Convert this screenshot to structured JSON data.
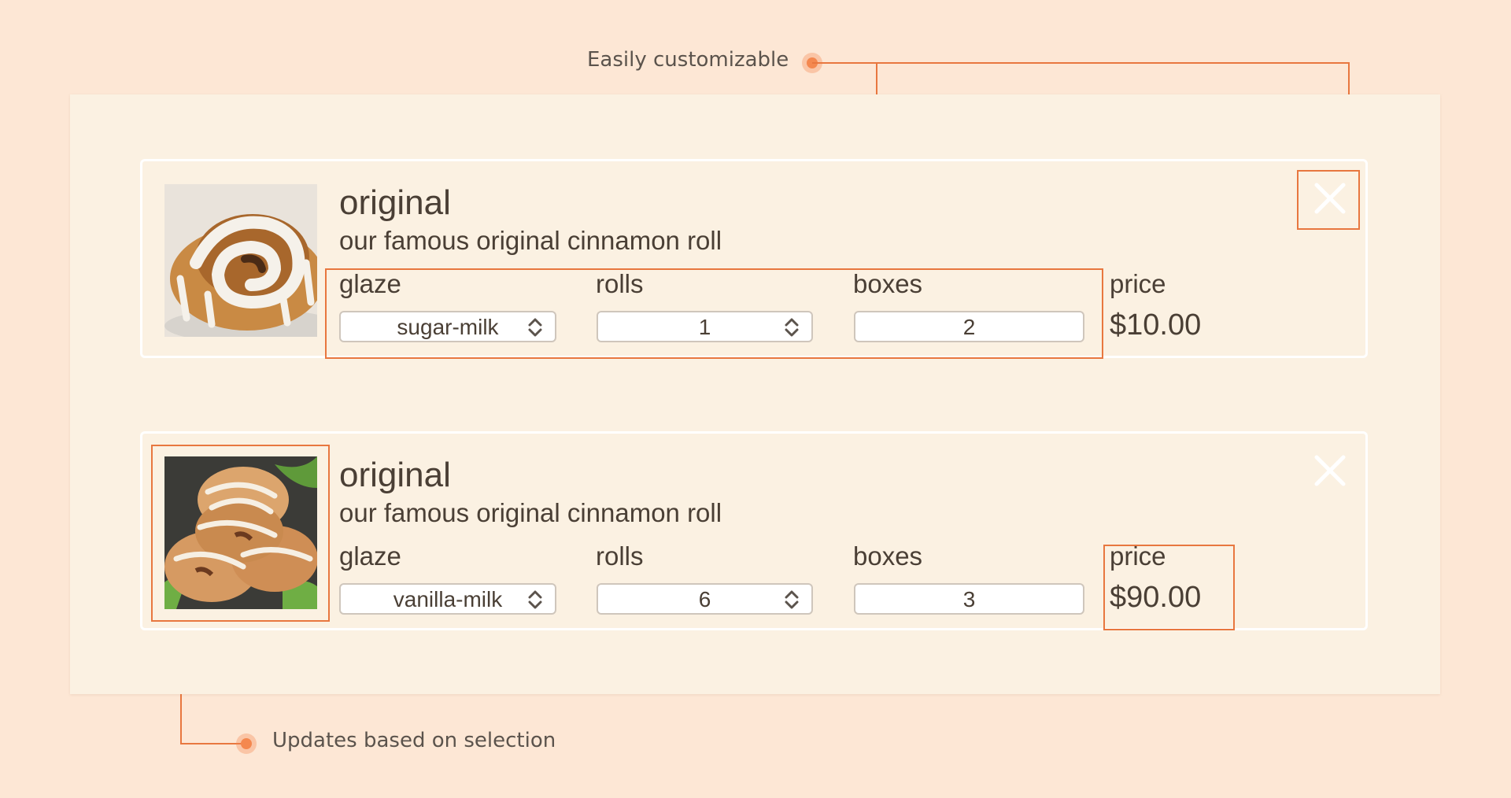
{
  "annotations": {
    "top": "Easily customizable",
    "bottom": "Updates based on selection"
  },
  "items": [
    {
      "image": "glazed-cinnamon-roll",
      "title": "original",
      "description": "our famous original cinnamon roll",
      "glaze_label": "glaze",
      "glaze_value": "sugar-milk",
      "rolls_label": "rolls",
      "rolls_value": "1",
      "boxes_label": "boxes",
      "boxes_value": "2",
      "price_label": "price",
      "price_value": "$10.00"
    },
    {
      "image": "stacked-cinnamon-rolls",
      "title": "original",
      "description": "our famous original cinnamon roll",
      "glaze_label": "glaze",
      "glaze_value": "vanilla-milk",
      "rolls_label": "rolls",
      "rolls_value": "6",
      "boxes_label": "boxes",
      "boxes_value": "3",
      "price_label": "price",
      "price_value": "$90.00"
    }
  ],
  "colors": {
    "background": "#fde7d5",
    "panel": "#fbf1e2",
    "accent": "#e8773f",
    "text": "#4a3f35"
  },
  "icons": [
    "close-icon",
    "stepper-icon"
  ]
}
